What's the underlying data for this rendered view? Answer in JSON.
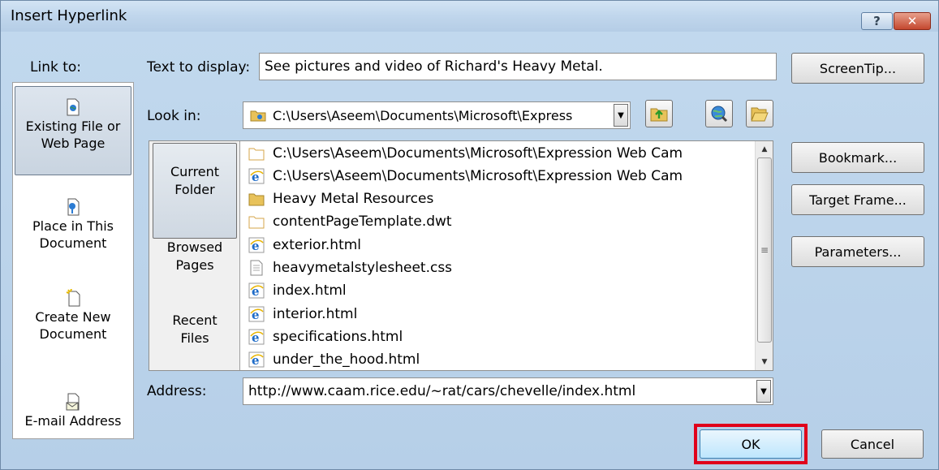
{
  "window": {
    "title": "Insert Hyperlink",
    "help_glyph": "?",
    "close_glyph": "✕"
  },
  "link_to": {
    "label": "Link to:",
    "items": [
      {
        "line1": "Existing File or",
        "line2": "Web Page",
        "icon": "web-page-icon",
        "selected": true
      },
      {
        "line1": "Place in This",
        "line2": "Document",
        "icon": "document-place-icon",
        "selected": false
      },
      {
        "line1": "Create New",
        "line2": "Document",
        "icon": "new-document-icon",
        "selected": false
      },
      {
        "line1": "E-mail Address",
        "line2": "",
        "icon": "email-icon",
        "selected": false
      }
    ]
  },
  "text_to_display": {
    "label": "Text to display:",
    "value": "See pictures and video of Richard's Heavy Metal."
  },
  "look_in": {
    "label": "Look in:",
    "value": "C:\\Users\\Aseem\\Documents\\Microsoft\\Express"
  },
  "view_tabs": [
    {
      "line1": "Current",
      "line2": "Folder",
      "selected": true
    },
    {
      "line1": "Browsed",
      "line2": "Pages",
      "selected": false
    },
    {
      "line1": "Recent",
      "line2": "Files",
      "selected": false
    }
  ],
  "files": [
    {
      "name": "C:\\Users\\Aseem\\Documents\\Microsoft\\Expression Web Cam",
      "icon": "blank-folder-icon"
    },
    {
      "name": "C:\\Users\\Aseem\\Documents\\Microsoft\\Expression Web Cam",
      "icon": "ie-html-icon"
    },
    {
      "name": "Heavy Metal Resources",
      "icon": "folder-icon"
    },
    {
      "name": "contentPageTemplate.dwt",
      "icon": "blank-folder-icon"
    },
    {
      "name": "exterior.html",
      "icon": "ie-html-icon"
    },
    {
      "name": "heavymetalstylesheet.css",
      "icon": "text-file-icon"
    },
    {
      "name": "index.html",
      "icon": "ie-html-icon"
    },
    {
      "name": "interior.html",
      "icon": "ie-html-icon"
    },
    {
      "name": "specifications.html",
      "icon": "ie-html-icon"
    },
    {
      "name": "under_the_hood.html",
      "icon": "ie-html-icon"
    }
  ],
  "address": {
    "label": "Address:",
    "value": "http://www.caam.rice.edu/~rat/cars/chevelle/index.html"
  },
  "side_buttons": {
    "screentip": "ScreenTip...",
    "bookmark": "Bookmark...",
    "target_frame": "Target Frame...",
    "parameters": "Parameters..."
  },
  "footer": {
    "ok": "OK",
    "cancel": "Cancel"
  },
  "colors": {
    "highlight_frame": "#e0001b",
    "title_bar": "#c0d6ec"
  }
}
